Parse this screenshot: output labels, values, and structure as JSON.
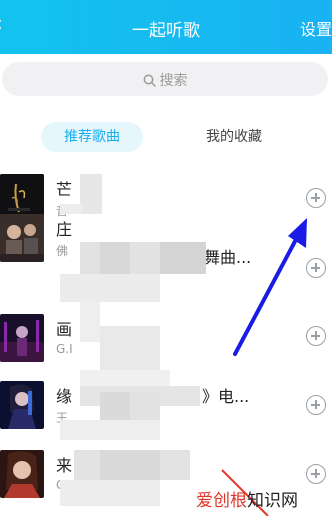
{
  "header": {
    "title": "一起听歌",
    "settings_label": "设置",
    "back_glyph": "‹"
  },
  "search": {
    "placeholder": "搜索"
  },
  "tabs": [
    {
      "label": "推荐歌曲",
      "active": true
    },
    {
      "label": "我的收藏",
      "active": false
    }
  ],
  "songs": [
    {
      "title": "芒",
      "subtitle": "音"
    },
    {
      "title": "庄",
      "title_tail": "舞曲...",
      "subtitle": "佛"
    },
    {
      "title": "画",
      "subtitle": "G.I"
    },
    {
      "title": "缘",
      "title_tail": "》电...",
      "subtitle": "王"
    },
    {
      "title": "来",
      "subtitle": "G.I"
    }
  ],
  "watermark": {
    "text_red": "爱创根",
    "text_black": "知识网"
  },
  "colors": {
    "header_start": "#13c3ef",
    "header_end": "#19b2f2",
    "accent": "#1ab0ee",
    "arrow": "#1b1be6"
  }
}
